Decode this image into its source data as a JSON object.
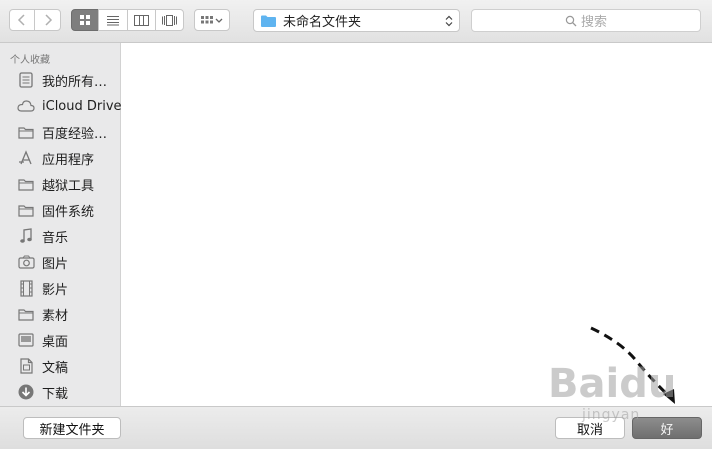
{
  "toolbar": {
    "back_icon": "chevron-left-icon",
    "forward_icon": "chevron-right-icon",
    "view_modes": [
      "icon-view",
      "list-view",
      "column-view",
      "cover-flow-view"
    ],
    "arrange_icon": "grid-arrange-icon",
    "path_folder_icon": "folder-icon",
    "path_label": "未命名文件夹",
    "search_placeholder": "搜索"
  },
  "sidebar": {
    "section_label": "个人收藏",
    "items": [
      {
        "label": "我的所有…",
        "icon": "all-files-icon"
      },
      {
        "label": "iCloud Drive",
        "icon": "cloud-icon"
      },
      {
        "label": "百度经验…",
        "icon": "folder-icon"
      },
      {
        "label": "应用程序",
        "icon": "applications-icon"
      },
      {
        "label": "越狱工具",
        "icon": "folder-icon"
      },
      {
        "label": "固件系统",
        "icon": "folder-icon"
      },
      {
        "label": "音乐",
        "icon": "music-icon"
      },
      {
        "label": "图片",
        "icon": "camera-icon"
      },
      {
        "label": "影片",
        "icon": "film-icon"
      },
      {
        "label": "素材",
        "icon": "folder-icon"
      },
      {
        "label": "桌面",
        "icon": "desktop-icon"
      },
      {
        "label": "文稿",
        "icon": "document-icon"
      },
      {
        "label": "下载",
        "icon": "download-icon"
      }
    ]
  },
  "footer": {
    "new_folder_label": "新建文件夹",
    "cancel_label": "取消",
    "ok_label": "好"
  },
  "watermark": {
    "text": "Baidu",
    "sub": "jingyan"
  },
  "colors": {
    "folder": "#5fb4f0",
    "selected_segment": "#7e7e7e"
  }
}
